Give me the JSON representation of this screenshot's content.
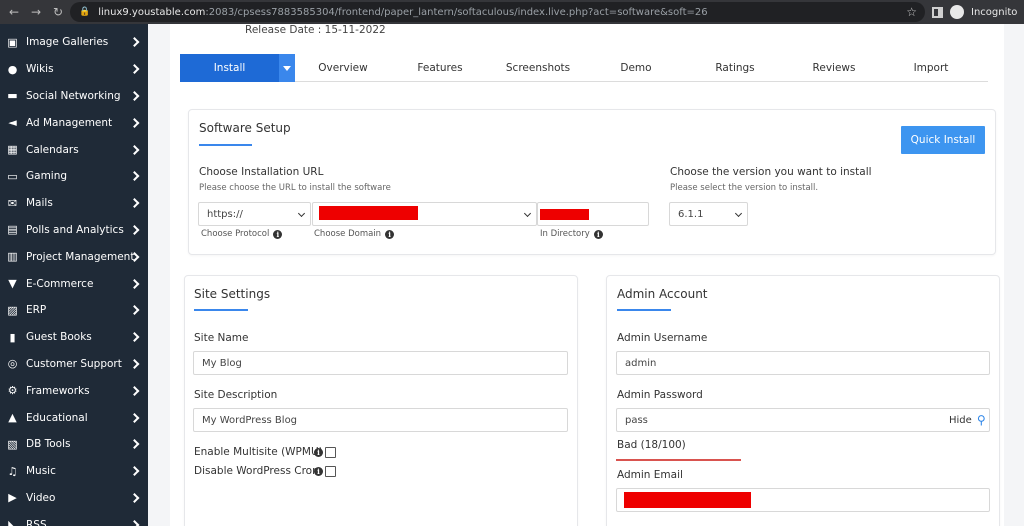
{
  "browser": {
    "url_host": "linux9.youstable.com",
    "url_path": ":2083/cpsess7883585304/frontend/paper_lantern/softaculous/index.live.php?act=software&soft=26",
    "incognito_label": "Incognito"
  },
  "sidebar": {
    "items": [
      {
        "label": "Image Galleries",
        "icon": "image-icon"
      },
      {
        "label": "Wikis",
        "icon": "globe-icon"
      },
      {
        "label": "Social Networking",
        "icon": "chat-icon"
      },
      {
        "label": "Ad Management",
        "icon": "megaphone-icon"
      },
      {
        "label": "Calendars",
        "icon": "calendar-icon"
      },
      {
        "label": "Gaming",
        "icon": "gamepad-icon"
      },
      {
        "label": "Mails",
        "icon": "envelope-icon"
      },
      {
        "label": "Polls and Analytics",
        "icon": "poll-icon"
      },
      {
        "label": "Project Management",
        "icon": "clipboard-icon"
      },
      {
        "label": "E-Commerce",
        "icon": "cart-icon"
      },
      {
        "label": "ERP",
        "icon": "chart-icon"
      },
      {
        "label": "Guest Books",
        "icon": "book-icon"
      },
      {
        "label": "Customer Support",
        "icon": "lifebuoy-icon"
      },
      {
        "label": "Frameworks",
        "icon": "cogs-icon"
      },
      {
        "label": "Educational",
        "icon": "graduation-cap-icon"
      },
      {
        "label": "DB Tools",
        "icon": "database-icon"
      },
      {
        "label": "Music",
        "icon": "music-icon"
      },
      {
        "label": "Video",
        "icon": "video-icon"
      },
      {
        "label": "RSS",
        "icon": "rss-icon"
      }
    ]
  },
  "release": "Release Date : 15-11-2022",
  "tabs": {
    "install": "Install",
    "items": [
      "Overview",
      "Features",
      "Screenshots",
      "Demo",
      "Ratings",
      "Reviews",
      "Import"
    ]
  },
  "software_setup": {
    "title": "Software Setup",
    "quick_install": "Quick Install",
    "install_url_label": "Choose Installation URL",
    "install_url_sub": "Please choose the URL to install the software",
    "protocol_value": "https://",
    "protocol_hint": "Choose Protocol",
    "domain_hint": "Choose Domain",
    "directory_hint": "In Directory",
    "version_label": "Choose the version you want to install",
    "version_sub": "Please select the version to install.",
    "version_value": "6.1.1"
  },
  "site_settings": {
    "title": "Site Settings",
    "site_name_label": "Site Name",
    "site_name_value": "My Blog",
    "site_desc_label": "Site Description",
    "site_desc_value": "My WordPress Blog",
    "multisite_label": "Enable Multisite (WPMU)",
    "cron_label": "Disable WordPress Cron"
  },
  "admin_account": {
    "title": "Admin Account",
    "username_label": "Admin Username",
    "username_value": "admin",
    "password_label": "Admin Password",
    "password_value": "pass",
    "hide_label": "Hide",
    "strength_text": "Bad (18/100)",
    "email_label": "Admin Email"
  },
  "colors": {
    "sidebar_bg": "#1f2a37",
    "accent": "#1e6ad6",
    "quick_install": "#3d95f0",
    "redaction": "#ee0000",
    "strength_bad": "#d9534f"
  }
}
